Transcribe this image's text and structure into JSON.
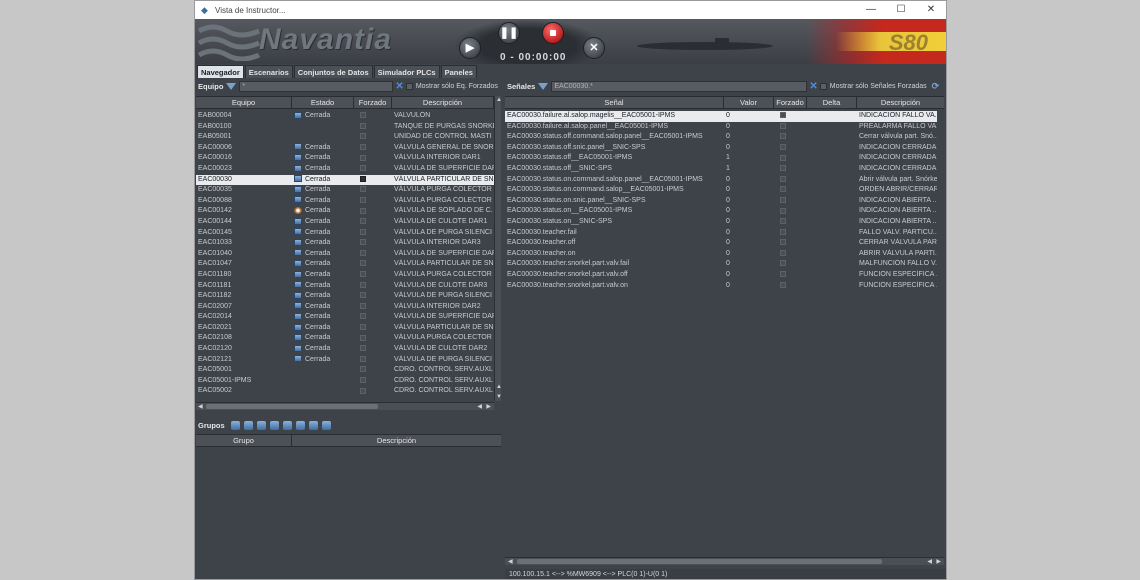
{
  "window": {
    "title": "Vista de Instructor..."
  },
  "banner": {
    "brand": "Navantia",
    "timer": "0 - 00:00:00",
    "model": "S80"
  },
  "tabs": [
    {
      "label": "Navegador",
      "active": true
    },
    {
      "label": "Escenarios",
      "active": false
    },
    {
      "label": "Conjuntos de Datos",
      "active": false
    },
    {
      "label": "Simulador PLCs",
      "active": false
    },
    {
      "label": "Paneles",
      "active": false
    }
  ],
  "equipo": {
    "title": "Equipo",
    "filter_value": "*",
    "checkbox_label": "Mostrar sólo Eq. Forzados",
    "columns": [
      "Equipo",
      "Estado",
      "Forzado",
      "Descripción"
    ],
    "rows": [
      {
        "id": "EAB00004",
        "estado": "Cerrada",
        "icon": "valve-icon",
        "forzado": false,
        "desc": "VALVULÓN"
      },
      {
        "id": "EAB00100",
        "estado": "",
        "icon": "",
        "forzado": false,
        "desc": "TANQUE DE PURGAS SNORKE"
      },
      {
        "id": "EAB05001",
        "estado": "",
        "icon": "",
        "forzado": false,
        "desc": "UNIDAD DE CONTROL MASTI"
      },
      {
        "id": "EAC00006",
        "estado": "Cerrada",
        "icon": "valve-icon",
        "forzado": false,
        "desc": "VÁLVULA GENERAL DE SNOR"
      },
      {
        "id": "EAC00016",
        "estado": "Cerrada",
        "icon": "valve-icon",
        "forzado": false,
        "desc": "VÁLVULA INTERIOR DAR1"
      },
      {
        "id": "EAC00023",
        "estado": "Cerrada",
        "icon": "valve-icon",
        "forzado": false,
        "desc": "VÁLVULA DE SUPERFICIE DAR"
      },
      {
        "id": "EAC00030",
        "estado": "Cerrada",
        "icon": "valve-icon",
        "forzado": true,
        "desc": "VÁLVULA PARTICULAR DE SN",
        "selected": true
      },
      {
        "id": "EAC00035",
        "estado": "Cerrada",
        "icon": "valve-icon",
        "forzado": false,
        "desc": "VÁLVULA PURGA COLECTOR"
      },
      {
        "id": "EAC00088",
        "estado": "Cerrada",
        "icon": "valve-icon",
        "forzado": false,
        "desc": "VÁLVULA PURGA COLECTOR"
      },
      {
        "id": "EAC00142",
        "estado": "Cerrada",
        "icon": "gear-icon",
        "forzado": false,
        "desc": "VÁLVULA DE SOPLADO DE C."
      },
      {
        "id": "EAC00144",
        "estado": "Cerrada",
        "icon": "valve-icon",
        "forzado": false,
        "desc": "VÁLVULA DE CULOTE DAR1"
      },
      {
        "id": "EAC00145",
        "estado": "Cerrada",
        "icon": "valve-icon",
        "forzado": false,
        "desc": "VÁLVULA DE PURGA SILENCI"
      },
      {
        "id": "EAC01033",
        "estado": "Cerrada",
        "icon": "valve-icon",
        "forzado": false,
        "desc": "VÁLVULA INTERIOR DAR3"
      },
      {
        "id": "EAC01040",
        "estado": "Cerrada",
        "icon": "valve-icon",
        "forzado": false,
        "desc": "VÁLVULA DE SUPERFICIE DAR"
      },
      {
        "id": "EAC01047",
        "estado": "Cerrada",
        "icon": "valve-icon",
        "forzado": false,
        "desc": "VÁLVULA PARTICULAR DE SN"
      },
      {
        "id": "EAC01180",
        "estado": "Cerrada",
        "icon": "valve-icon",
        "forzado": false,
        "desc": "VÁLVULA PURGA COLECTOR"
      },
      {
        "id": "EAC01181",
        "estado": "Cerrada",
        "icon": "valve-icon",
        "forzado": false,
        "desc": "VÁLVULA DE CULOTE DAR3"
      },
      {
        "id": "EAC01182",
        "estado": "Cerrada",
        "icon": "valve-icon",
        "forzado": false,
        "desc": "VÁLVULA DE PURGA SILENCI"
      },
      {
        "id": "EAC02007",
        "estado": "Cerrada",
        "icon": "valve-icon",
        "forzado": false,
        "desc": "VÁLVULA INTERIOR DAR2"
      },
      {
        "id": "EAC02014",
        "estado": "Cerrada",
        "icon": "valve-icon",
        "forzado": false,
        "desc": "VÁLVULA DE SUPERFICIE DAR"
      },
      {
        "id": "EAC02021",
        "estado": "Cerrada",
        "icon": "valve-icon",
        "forzado": false,
        "desc": "VÁLVULA PARTICULAR DE SN"
      },
      {
        "id": "EAC02108",
        "estado": "Cerrada",
        "icon": "valve-icon",
        "forzado": false,
        "desc": "VÁLVULA PURGA COLECTOR"
      },
      {
        "id": "EAC02120",
        "estado": "Cerrada",
        "icon": "valve-icon",
        "forzado": false,
        "desc": "VÁLVULA DE CULOTE DAR2"
      },
      {
        "id": "EAC02121",
        "estado": "Cerrada",
        "icon": "valve-icon",
        "forzado": false,
        "desc": "VÁLVULA DE PURGA SILENCI"
      },
      {
        "id": "EAC05001",
        "estado": "",
        "icon": "",
        "forzado": false,
        "desc": "CDRO. CONTROL SERV.AUXL"
      },
      {
        "id": "EAC05001-IPMS",
        "estado": "",
        "icon": "",
        "forzado": false,
        "desc": "CDRO. CONTROL SERV.AUXL"
      },
      {
        "id": "EAC05002",
        "estado": "",
        "icon": "",
        "forzado": false,
        "desc": "CDRO. CONTROL SERV.AUXL"
      }
    ]
  },
  "grupos": {
    "title": "Grupos",
    "columns": [
      "Grupo",
      "Descripción"
    ]
  },
  "senales": {
    "title": "Señales",
    "filter_value": "EAC00030.*",
    "checkbox_label": "Mostrar sólo Señales Forzadas",
    "columns": [
      "Señal",
      "Valor",
      "Forzado",
      "Delta",
      "Descripción"
    ],
    "rows": [
      {
        "signal": "EAC00030.failure.al.salop.magelis__EAC05001-IPMS",
        "valor": "0",
        "forzado": false,
        "delta": "",
        "desc": "INDICACION FALLO VA...",
        "selected": true
      },
      {
        "signal": "EAC00030.failure.al.salop.panel__EAC05001-IPMS",
        "valor": "0",
        "forzado": false,
        "delta": "",
        "desc": "PREALARMA FALLO VA..."
      },
      {
        "signal": "EAC00030.status.off.command.salop.panel__EAC05001-IPMS",
        "valor": "0",
        "forzado": false,
        "delta": "",
        "desc": "Cerrar válvula part. Snó..."
      },
      {
        "signal": "EAC00030.status.off.snic.panel__SNIC-SPS",
        "valor": "0",
        "forzado": false,
        "delta": "",
        "desc": "INDICACION CERRADA..."
      },
      {
        "signal": "EAC00030.status.off__EAC05001-IPMS",
        "valor": "1",
        "forzado": false,
        "delta": "",
        "desc": "INDICACION CERRADA..."
      },
      {
        "signal": "EAC00030.status.off__SNIC-SPS",
        "valor": "1",
        "forzado": false,
        "delta": "",
        "desc": "INDICACION CERRADA..."
      },
      {
        "signal": "EAC00030.status.on.command.salop.panel__EAC05001-IPMS",
        "valor": "0",
        "forzado": false,
        "delta": "",
        "desc": "Abrir válvula part. Snórkel"
      },
      {
        "signal": "EAC00030.status.on.command.salop__EAC05001-IPMS",
        "valor": "0",
        "forzado": false,
        "delta": "",
        "desc": "ORDEN ABRIR/CERRAR ..."
      },
      {
        "signal": "EAC00030.status.on.snic.panel__SNIC-SPS",
        "valor": "0",
        "forzado": false,
        "delta": "",
        "desc": "INDICACION ABIERTA ..."
      },
      {
        "signal": "EAC00030.status.on__EAC05001-IPMS",
        "valor": "0",
        "forzado": false,
        "delta": "",
        "desc": "INDICACION ABIERTA ..."
      },
      {
        "signal": "EAC00030.status.on__SNIC-SPS",
        "valor": "0",
        "forzado": false,
        "delta": "",
        "desc": "INDICACION ABIERTA ..."
      },
      {
        "signal": "EAC00030.teacher.fail",
        "valor": "0",
        "forzado": false,
        "delta": "",
        "desc": "FALLO VALV. PARTICU..."
      },
      {
        "signal": "EAC00030.teacher.off",
        "valor": "0",
        "forzado": false,
        "delta": "",
        "desc": "CERRAR VÁLVULA PAR..."
      },
      {
        "signal": "EAC00030.teacher.on",
        "valor": "0",
        "forzado": false,
        "delta": "",
        "desc": "ABRIR VÁLVULA PARTI..."
      },
      {
        "signal": "EAC00030.teacher.snorkel.part.valv.fail",
        "valor": "0",
        "forzado": false,
        "delta": "",
        "desc": "MALFUNCIÓN FALLO V..."
      },
      {
        "signal": "EAC00030.teacher.snorkel.part.valv.off",
        "valor": "0",
        "forzado": false,
        "delta": "",
        "desc": "FUNCIÓN ESPECÍFICA ..."
      },
      {
        "signal": "EAC00030.teacher.snorkel.part.valv.on",
        "valor": "0",
        "forzado": false,
        "delta": "",
        "desc": "FUNCIÓN ESPECÍFICA ..."
      }
    ]
  },
  "status_bar": {
    "text": "100.100.15.1 <--> %MW6909 <--> PLC(0 1)-U(0 1)"
  },
  "colors": {
    "background": "#3e4249",
    "selected_row": "#e9ebee",
    "accent_blue": "#7aa0cc",
    "flag_red": "#c5281c",
    "flag_yellow": "#f0cf3a"
  }
}
